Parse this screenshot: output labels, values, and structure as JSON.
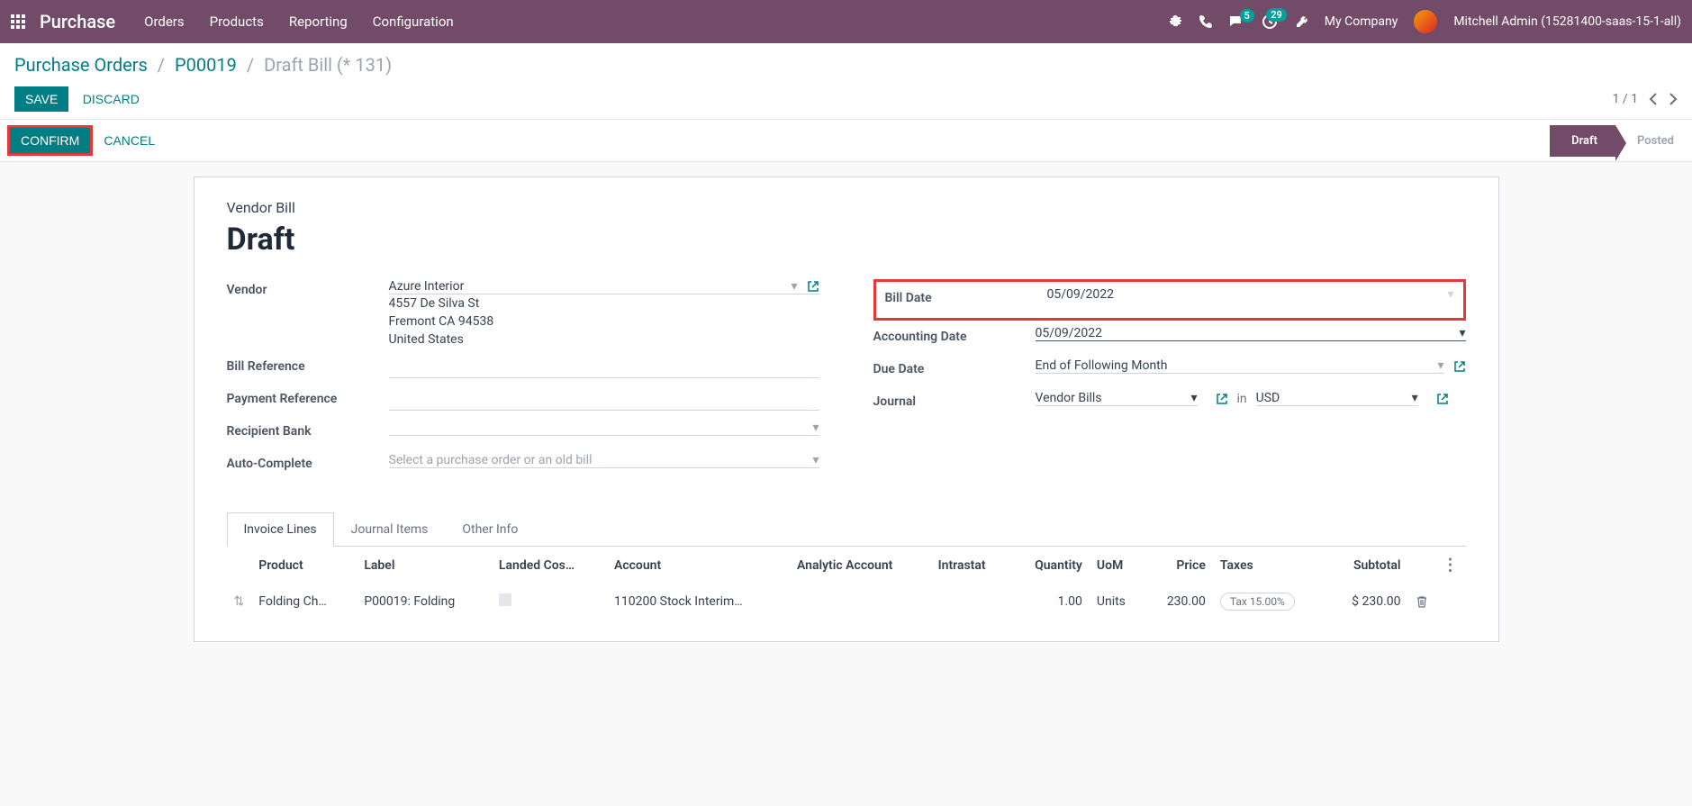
{
  "nav": {
    "brand": "Purchase",
    "menu": [
      "Orders",
      "Products",
      "Reporting",
      "Configuration"
    ],
    "company": "My Company",
    "user": "Mitchell Admin (15281400-saas-15-1-all)",
    "badge_msg": "5",
    "badge_act": "29"
  },
  "breadcrumb": {
    "root": "Purchase Orders",
    "po": "P00019",
    "current": "Draft Bill (* 131)"
  },
  "buttons": {
    "save": "Save",
    "discard": "Discard",
    "confirm": "Confirm",
    "cancel": "Cancel"
  },
  "pager": {
    "text": "1 / 1"
  },
  "status": {
    "draft": "Draft",
    "posted": "Posted"
  },
  "sheet": {
    "title_label": "Vendor Bill",
    "title": "Draft"
  },
  "fields": {
    "vendor_label": "Vendor",
    "vendor": "Azure Interior",
    "vendor_addr1": "4557 De Silva St",
    "vendor_addr2": "Fremont CA 94538",
    "vendor_addr3": "United States",
    "bill_ref_label": "Bill Reference",
    "pay_ref_label": "Payment Reference",
    "recipient_bank_label": "Recipient Bank",
    "auto_complete_label": "Auto-Complete",
    "auto_complete_placeholder": "Select a purchase order or an old bill",
    "bill_date_label": "Bill Date",
    "bill_date": "05/09/2022",
    "acct_date_label": "Accounting Date",
    "acct_date": "05/09/2022",
    "due_date_label": "Due Date",
    "due_date": "End of Following Month",
    "journal_label": "Journal",
    "journal": "Vendor Bills",
    "in": "in",
    "currency": "USD"
  },
  "tabs": [
    "Invoice Lines",
    "Journal Items",
    "Other Info"
  ],
  "table": {
    "headers": [
      "Product",
      "Label",
      "Landed Cos…",
      "Account",
      "Analytic Account",
      "Intrastat",
      "Quantity",
      "UoM",
      "Price",
      "Taxes",
      "Subtotal"
    ],
    "row": {
      "product": "Folding Ch…",
      "label": "P00019: Folding",
      "account": "110200 Stock Interim…",
      "qty": "1.00",
      "uom": "Units",
      "price": "230.00",
      "tax": "Tax 15.00%",
      "subtotal": "$ 230.00"
    }
  }
}
